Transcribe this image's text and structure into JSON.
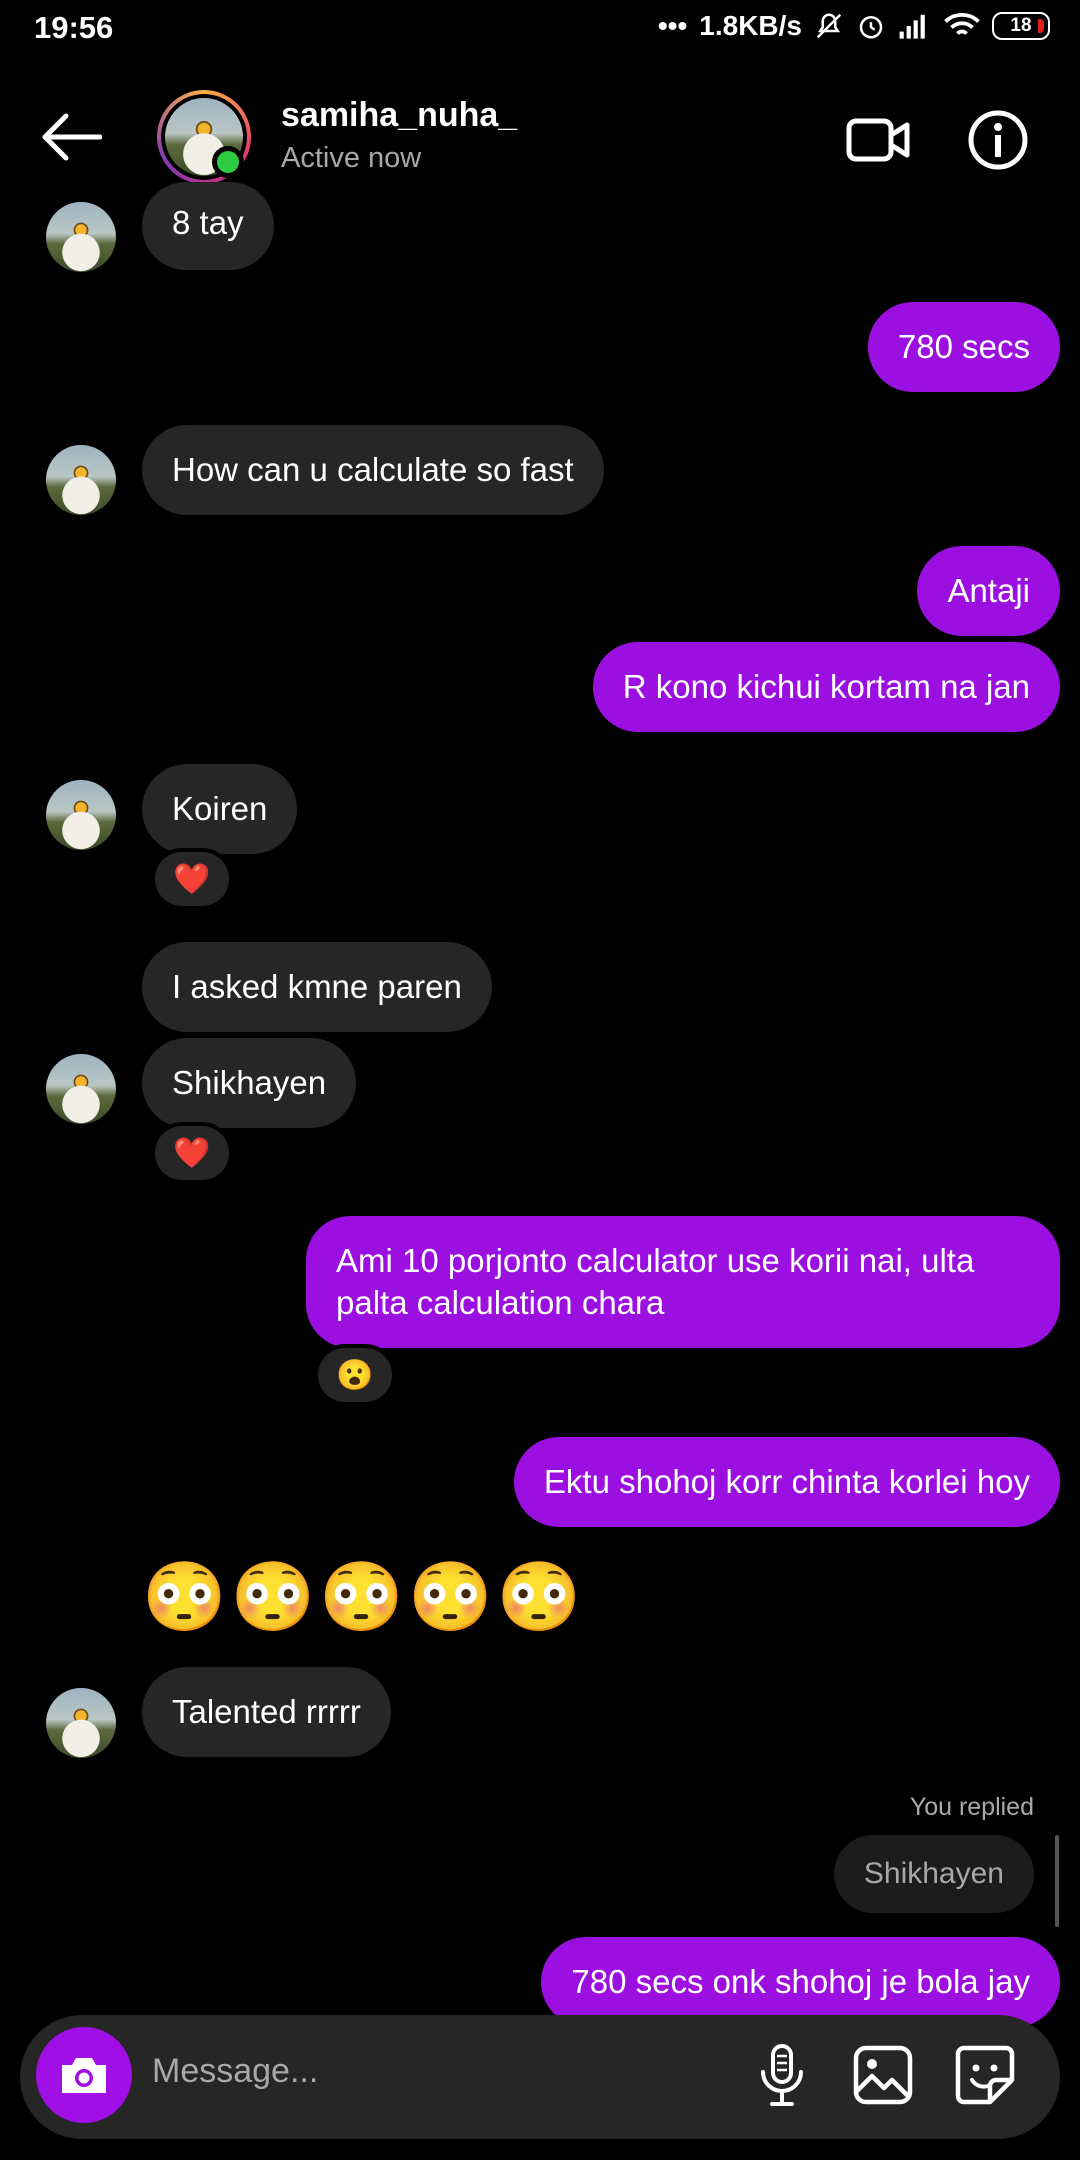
{
  "status_bar": {
    "time": "19:56",
    "network_speed": "1.8KB/s",
    "battery": "18"
  },
  "header": {
    "username": "samiha_nuha_",
    "presence": "Active now",
    "online_indicator_color": "#2ecc40"
  },
  "colors": {
    "outgoing_bubble": "#9b0fe0",
    "incoming_bubble": "#262626",
    "background": "#000000",
    "camera_button": "#a00fe6"
  },
  "messages": [
    {
      "direction": "in",
      "text": "8 tay"
    },
    {
      "direction": "out",
      "text": "780 secs"
    },
    {
      "direction": "in",
      "text": "How can u calculate so fast"
    },
    {
      "direction": "out",
      "text": "Antaji"
    },
    {
      "direction": "out",
      "text": "R kono kichui kortam na jan"
    },
    {
      "direction": "in",
      "text": "Koiren",
      "reaction": "❤️"
    },
    {
      "direction": "in",
      "text": "I asked kmne paren"
    },
    {
      "direction": "in",
      "text": "Shikhayen",
      "reaction": "❤️"
    },
    {
      "direction": "out",
      "text_line1": "Ami 10 porjonto calculator use korii nai, ulta",
      "text_line2": "palta calculation chara",
      "reaction": "😮"
    },
    {
      "direction": "out",
      "text": "Ektu shohoj korr chinta korlei hoy"
    },
    {
      "direction": "in",
      "text": "😳😳😳😳😳"
    },
    {
      "direction": "in",
      "text": "Talented rrrrr"
    },
    {
      "direction": "out",
      "reply_label": "You replied",
      "quoted": "Shikhayen",
      "text": "780 secs onk shohoj je bola jay"
    }
  ],
  "composer": {
    "placeholder": "Message..."
  }
}
